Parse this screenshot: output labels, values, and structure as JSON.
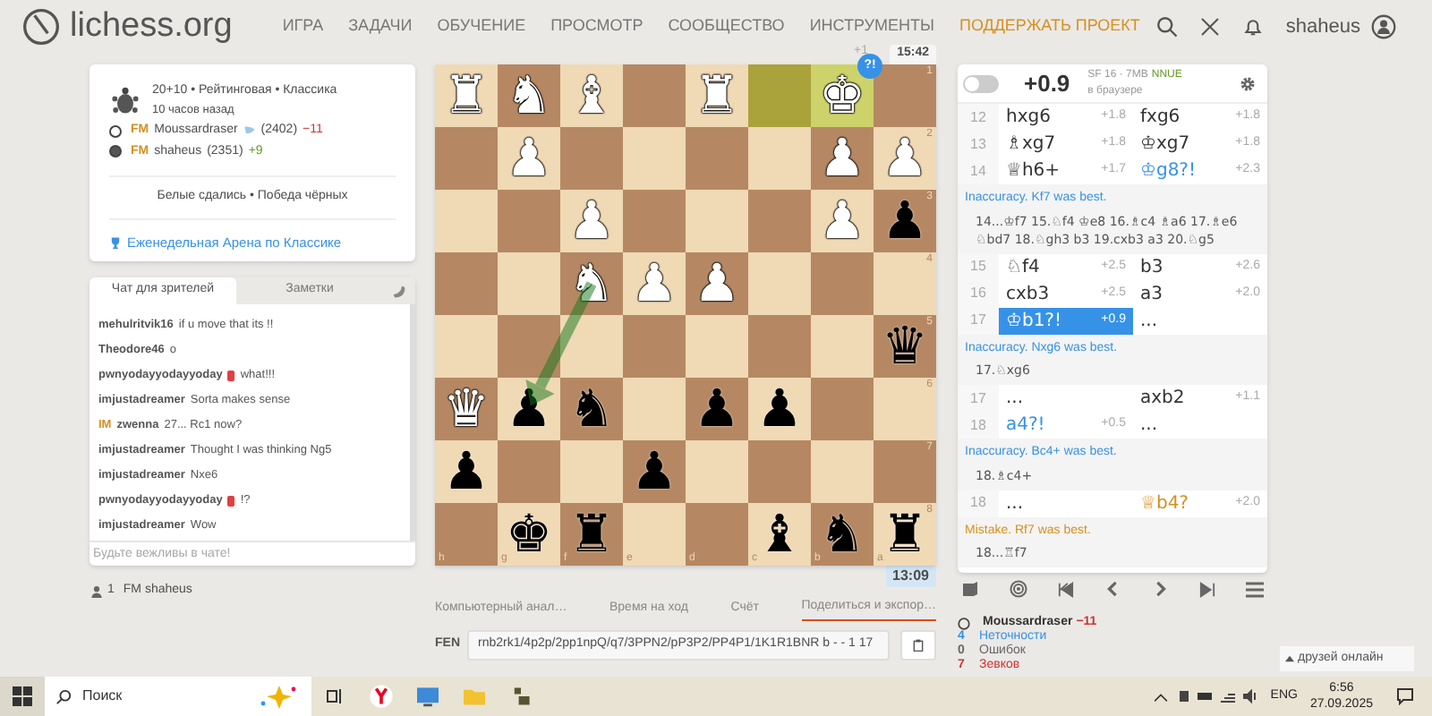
{
  "nav": {
    "logo": "lichess.org",
    "items": [
      {
        "label": "ИГРА",
        "highlight": false
      },
      {
        "label": "ЗАДАЧИ",
        "highlight": false
      },
      {
        "label": "ОБУЧЕНИЕ",
        "highlight": false
      },
      {
        "label": "ПРОСМОТР",
        "highlight": false
      },
      {
        "label": "СООБЩЕСТВО",
        "highlight": false
      },
      {
        "label": "ИНСТРУМЕНТЫ",
        "highlight": false
      },
      {
        "label": "ПОДДЕРЖАТЬ ПРОЕКТ",
        "highlight": true
      }
    ],
    "user": "shaheus"
  },
  "game": {
    "meta": "20+10 • Рейтинговая • Классика",
    "ago": "10 часов назад",
    "players": [
      {
        "kind": "white",
        "title": "FM",
        "name": "Moussardraser",
        "patron": true,
        "rating": "(2402)",
        "diff": "−11",
        "loss": true
      },
      {
        "kind": "black",
        "title": "FM",
        "name": "shaheus",
        "patron": false,
        "rating": "(2351)",
        "diff": "+9",
        "loss": false
      }
    ],
    "result": "Белые сдались • Победа чёрных",
    "tournament": "Еженедельная Арена по Классике"
  },
  "chat": {
    "tabs": [
      {
        "label": "Чат для зрителей",
        "selected": true
      },
      {
        "label": "Заметки",
        "selected": false
      }
    ],
    "messages": [
      {
        "user": "mehulritvik16",
        "text": "if u move that its !!",
        "flair": false
      },
      {
        "user": "Theodore46",
        "text": "o",
        "flair": false
      },
      {
        "user": "pwnyodayyodayyoday",
        "text": "what!!!",
        "flair": true
      },
      {
        "user": "imjustadreamer",
        "text": "Sorta makes sense",
        "flair": false
      },
      {
        "title": "IM",
        "user": "zwenna",
        "text": "27... Rc1 now?",
        "flair": false
      },
      {
        "user": "imjustadreamer",
        "text": "Thought I was thinking Ng5",
        "flair": false
      },
      {
        "user": "imjustadreamer",
        "text": "Nxe6",
        "flair": false
      },
      {
        "user": "pwnyodayyodayyoday",
        "text": "!?",
        "flair": true
      },
      {
        "user": "imjustadreamer",
        "text": "Wow",
        "flair": false
      }
    ],
    "placeholder": "Будьте вежливы в чате!"
  },
  "spectators": {
    "count": "1",
    "names": "FM shaheus"
  },
  "board": {
    "clock_top": "15:42",
    "clock_bottom": "13:09",
    "material": "+1",
    "files": [
      "h",
      "g",
      "f",
      "e",
      "d",
      "c",
      "b",
      "a"
    ],
    "ranks": [
      "1",
      "2",
      "3",
      "4",
      "5",
      "6",
      "7",
      "8"
    ],
    "rows": [
      [
        {
          "highlight": false,
          "piece": "♜",
          "kind": "white"
        },
        {
          "highlight": false,
          "piece": "♞",
          "kind": "white"
        },
        {
          "highlight": false,
          "piece": "♝",
          "kind": "white"
        },
        {
          "highlight": false
        },
        {
          "highlight": false,
          "piece": "♜",
          "kind": "white"
        },
        {
          "highlight": true
        },
        {
          "highlight": true,
          "piece": "♚",
          "kind": "white",
          "badge": "?!"
        },
        {
          "highlight": false
        }
      ],
      [
        {
          "highlight": false
        },
        {
          "highlight": false,
          "piece": "♟",
          "kind": "white"
        },
        {
          "highlight": false
        },
        {
          "highlight": false
        },
        {
          "highlight": false
        },
        {
          "highlight": false
        },
        {
          "highlight": false,
          "piece": "♟",
          "kind": "white"
        },
        {
          "highlight": false,
          "piece": "♟",
          "kind": "white"
        }
      ],
      [
        {
          "highlight": false
        },
        {
          "highlight": false
        },
        {
          "highlight": false,
          "piece": "♟",
          "kind": "white"
        },
        {
          "highlight": false
        },
        {
          "highlight": false
        },
        {
          "highlight": false
        },
        {
          "highlight": false,
          "piece": "♟",
          "kind": "white"
        },
        {
          "highlight": false,
          "piece": "♟",
          "kind": "black"
        }
      ],
      [
        {
          "highlight": false
        },
        {
          "highlight": false
        },
        {
          "highlight": false,
          "piece": "♞",
          "kind": "white",
          "arrow_from": true
        },
        {
          "highlight": false,
          "piece": "♟",
          "kind": "white"
        },
        {
          "highlight": false,
          "piece": "♟",
          "kind": "white"
        },
        {
          "highlight": false
        },
        {
          "highlight": false
        },
        {
          "highlight": false
        }
      ],
      [
        {
          "highlight": false
        },
        {
          "highlight": false
        },
        {
          "highlight": false
        },
        {
          "highlight": false
        },
        {
          "highlight": false
        },
        {
          "highlight": false
        },
        {
          "highlight": false
        },
        {
          "highlight": false,
          "piece": "♛",
          "kind": "black"
        }
      ],
      [
        {
          "highlight": false,
          "piece": "♛",
          "kind": "white"
        },
        {
          "highlight": false,
          "piece": "♟",
          "kind": "black",
          "arrow_to": true
        },
        {
          "highlight": false,
          "piece": "♞",
          "kind": "black"
        },
        {
          "highlight": false
        },
        {
          "highlight": false,
          "piece": "♟",
          "kind": "black"
        },
        {
          "highlight": false,
          "piece": "♟",
          "kind": "black"
        },
        {
          "highlight": false
        },
        {
          "highlight": false
        }
      ],
      [
        {
          "highlight": false,
          "piece": "♟",
          "kind": "black"
        },
        {
          "highlight": false
        },
        {
          "highlight": false
        },
        {
          "highlight": false,
          "piece": "♟",
          "kind": "black"
        },
        {
          "highlight": false
        },
        {
          "highlight": false
        },
        {
          "highlight": false
        },
        {
          "highlight": false
        }
      ],
      [
        {
          "highlight": false
        },
        {
          "highlight": false,
          "piece": "♚",
          "kind": "black"
        },
        {
          "highlight": false,
          "piece": "♜",
          "kind": "black"
        },
        {
          "highlight": false
        },
        {
          "highlight": false
        },
        {
          "highlight": false,
          "piece": "♝",
          "kind": "black"
        },
        {
          "highlight": false,
          "piece": "♞",
          "kind": "black"
        },
        {
          "highlight": false,
          "piece": "♜",
          "kind": "black"
        }
      ]
    ]
  },
  "tools": {
    "tabs": [
      {
        "label": "Компьютерный анал…",
        "selected": false
      },
      {
        "label": "Время на ход",
        "selected": false
      },
      {
        "label": "Счёт",
        "selected": false
      },
      {
        "label": "Поделиться и экспор…",
        "selected": true
      }
    ],
    "fen_label": "FEN",
    "fen": "rnb2rk1/4p2p/2pp1npQ/q7/3PPN2/pP3P2/PP4P1/1K1R1BNR b - - 1 17"
  },
  "engine": {
    "on": false,
    "eval": "+0.9",
    "name": "SF 16 · 7MB",
    "nnue": "NNUE",
    "sub": "в браузере"
  },
  "moves": [
    {
      "kind": "row",
      "num": "12",
      "white": {
        "san": "hxg6",
        "eval": "+1.8",
        "kind": "normal",
        "selected": false
      },
      "black": {
        "san": "fxg6",
        "eval": "+1.8",
        "kind": "normal",
        "selected": false
      }
    },
    {
      "kind": "row",
      "num": "13",
      "white": {
        "san": "♗xg7",
        "eval": "+1.8",
        "kind": "normal",
        "selected": false
      },
      "black": {
        "san": "♔xg7",
        "eval": "+1.8",
        "kind": "normal",
        "selected": false
      }
    },
    {
      "kind": "row",
      "num": "14",
      "white": {
        "san": "♕h6+",
        "eval": "+1.7",
        "kind": "normal",
        "selected": false
      },
      "black": {
        "san": "♔g8?!",
        "eval": "+2.3",
        "kind": "inaccuracy",
        "selected": false
      }
    },
    {
      "kind": "comment",
      "mistake": false,
      "text": "Inaccuracy. Kf7 was best.",
      "line": "14...♔f7 15.♘f4 ♔e8 16.♗c4 ♗a6 17.♗e6 ♘bd7 18.♘gh3 b3 19.cxb3 a3 20.♘g5"
    },
    {
      "kind": "row",
      "num": "15",
      "white": {
        "san": "♘f4",
        "eval": "+2.5",
        "kind": "normal",
        "selected": false
      },
      "black": {
        "san": "b3",
        "eval": "+2.6",
        "kind": "normal",
        "selected": false
      }
    },
    {
      "kind": "row",
      "num": "16",
      "white": {
        "san": "cxb3",
        "eval": "+2.5",
        "kind": "normal",
        "selected": false
      },
      "black": {
        "san": "a3",
        "eval": "+2.0",
        "kind": "normal",
        "selected": false
      }
    },
    {
      "kind": "row",
      "num": "17",
      "white": {
        "san": "♔b1?!",
        "eval": "+0.9",
        "kind": "inaccuracy",
        "selected": true
      },
      "black": {
        "san": "...",
        "kind": "normal",
        "selected": false
      }
    },
    {
      "kind": "comment",
      "mistake": false,
      "text": "Inaccuracy. Nxg6 was best.",
      "line": "17.♘xg6"
    },
    {
      "kind": "row",
      "num": "17",
      "white": {
        "san": "...",
        "kind": "normal",
        "selected": false
      },
      "black": {
        "san": "axb2",
        "eval": "+1.1",
        "kind": "normal",
        "selected": false
      }
    },
    {
      "kind": "row",
      "num": "18",
      "white": {
        "san": "a4?!",
        "eval": "+0.5",
        "kind": "inaccuracy",
        "selected": false
      },
      "black": {
        "san": "...",
        "kind": "normal",
        "selected": false
      }
    },
    {
      "kind": "comment",
      "mistake": false,
      "text": "Inaccuracy. Bc4+ was best.",
      "line": "18.♗c4+"
    },
    {
      "kind": "row",
      "num": "18",
      "white": {
        "san": "...",
        "kind": "normal",
        "selected": false
      },
      "black": {
        "san": "♕b4?",
        "eval": "+2.0",
        "kind": "mistake",
        "selected": false
      }
    },
    {
      "kind": "comment",
      "mistake": true,
      "text": "Mistake. Rf7 was best.",
      "line": "18...♖f7"
    }
  ],
  "summary": {
    "player": "Moussardraser",
    "diff": "−11",
    "stats": [
      {
        "count": "4",
        "label": "Неточности",
        "kind": "inaccuracy"
      },
      {
        "count": "0",
        "label": "Ошибок",
        "kind": "none"
      },
      {
        "count": "7",
        "label": "Зевков",
        "kind": "blunder"
      }
    ]
  },
  "friends": "друзей онлайн",
  "taskbar": {
    "search": "Поиск",
    "lang": "ENG",
    "time": "6:56",
    "date": "27.09.2025"
  }
}
